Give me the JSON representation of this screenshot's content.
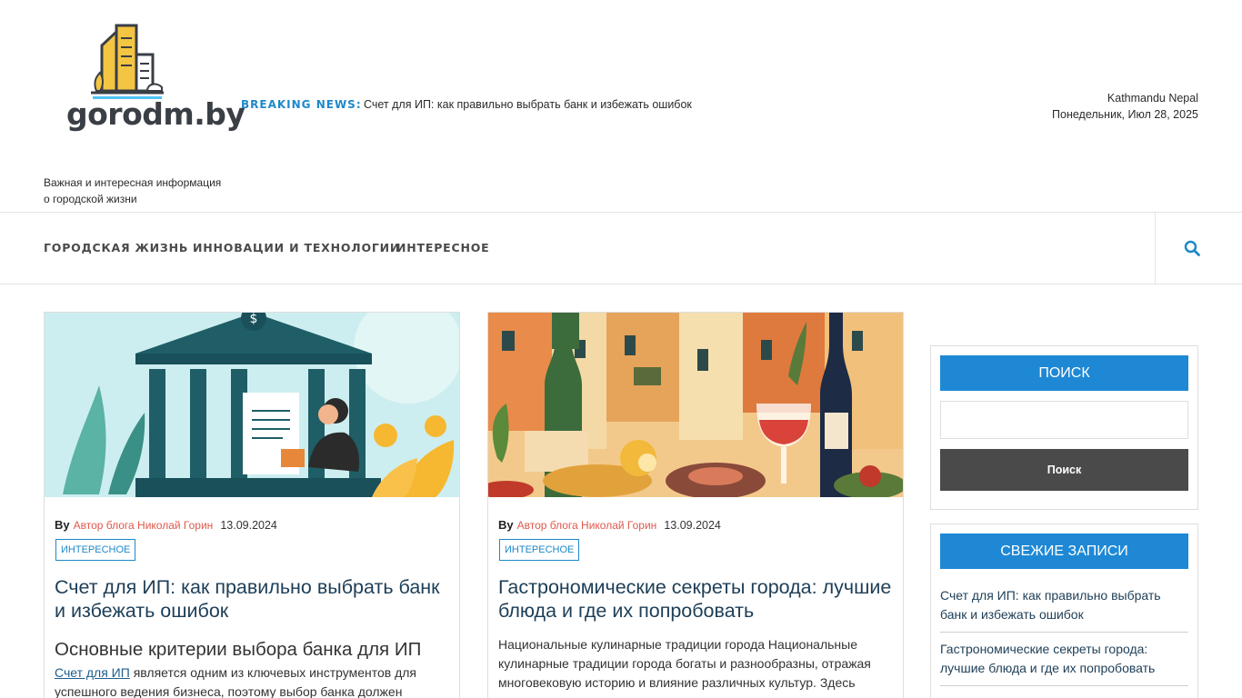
{
  "site": {
    "logo_text": "gorodm.by",
    "tagline": "Важная и интересная информация о городской жизни"
  },
  "breaking": {
    "label": "BREAKING NEWS:",
    "text": "Счет для ИП: как правильно выбрать банк и избежать ошибок"
  },
  "location": {
    "city": "Kathmandu Nepal",
    "date": "Понедельник, Июл 28, 2025"
  },
  "nav": {
    "items": [
      "ГОРОДСКАЯ ЖИЗНЬ",
      "ИННОВАЦИИ И ТЕХНОЛОГИИ",
      "ИНТЕРЕСНОЕ"
    ]
  },
  "posts": [
    {
      "by": "By",
      "author": "Автор блога Николай Горин",
      "date": "13.09.2024",
      "tag": "ИНТЕРЕСНОЕ",
      "title": "Счет для ИП: как правильно выбрать банк и избежать ошибок",
      "subheading": "Основные критерии выбора банка для ИП",
      "excerpt_link": "Счет для ИП",
      "excerpt": " является одним из ключевых инструментов для успешного ведения бизнеса, поэтому выбор банка должен"
    },
    {
      "by": "By",
      "author": "Автор блога Николай Горин",
      "date": "13.09.2024",
      "tag": "ИНТЕРЕСНОЕ",
      "title": "Гастрономические секреты города: лучшие блюда и где их попробовать",
      "excerpt": "Национальные кулинарные традиции города Национальные кулинарные традиции города богаты и разнообразны, отражая многовековую историю и влияние различных культур. Здесь"
    }
  ],
  "sidebar": {
    "search_title": "ПОИСК",
    "search_button": "Поиск",
    "recent_title": "СВЕЖИЕ ЗАПИСИ",
    "recent": [
      "Счет для ИП: как правильно выбрать банк и избежать ошибок",
      "Гастрономические секреты города: лучшие блюда и где их попробовать"
    ]
  },
  "colors": {
    "accent": "#1e88d5",
    "breaking": "#1e88c9",
    "author": "#e0584b",
    "title": "#1d3e57"
  },
  "icons": [
    "search-icon",
    "city-logo-icon"
  ]
}
